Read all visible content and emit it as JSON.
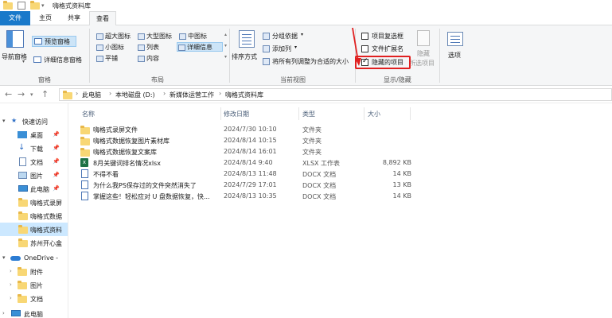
{
  "window": {
    "title": "嗨格式资料库"
  },
  "tabs": {
    "file": "文件",
    "home": "主页",
    "share": "共享",
    "view": "查看"
  },
  "ribbon": {
    "panes": {
      "nav_pane": "导航窗格",
      "preview_pane": "预览窗格",
      "details_pane": "详细信息窗格",
      "group": "窗格"
    },
    "layout": {
      "xl_icons": "超大图标",
      "large_icons": "大型图标",
      "medium_icons": "中图标",
      "small_icons": "小图标",
      "list": "列表",
      "details": "详细信息",
      "tiles": "平铺",
      "content": "内容",
      "group": "布局"
    },
    "current_view": {
      "sort_by": "排序方式",
      "group_by": "分组依据",
      "add_columns": "添加列",
      "size_all_columns": "将所有列调整为合适的大小",
      "group": "当前视图"
    },
    "show_hide": {
      "item_checkboxes": "项目复选框",
      "file_name_extensions": "文件扩展名",
      "hidden_items": "隐藏的项目",
      "hide_selected": "隐藏",
      "hide_selected_2": "所选项目",
      "group": "显示/隐藏",
      "item_checkboxes_checked": false,
      "extensions_checked": false,
      "hidden_items_checked": true
    },
    "options": "选项",
    "colors": {
      "file_tab": "#1979ca",
      "highlight": "#e02020"
    }
  },
  "address": {
    "crumbs": [
      "此电脑",
      "本地磁盘 (D:)",
      "新媒体运营工作",
      "嗨格式资料库"
    ]
  },
  "nav": {
    "quick_access": "快速访问",
    "items": [
      {
        "label": "桌面"
      },
      {
        "label": "下载"
      },
      {
        "label": "文档"
      },
      {
        "label": "图片"
      },
      {
        "label": "此电脑"
      },
      {
        "label": "嗨格式录屏"
      },
      {
        "label": "嗨格式数据"
      },
      {
        "label": "嗨格式资料"
      },
      {
        "label": "苏州开心盒"
      }
    ],
    "onedrive": "OneDrive -",
    "onedrive_items": [
      {
        "label": "附件"
      },
      {
        "label": "图片"
      },
      {
        "label": "文档"
      }
    ],
    "this_pc": "此电脑"
  },
  "list": {
    "headers": {
      "name": "名称",
      "modified": "修改日期",
      "type": "类型",
      "size": "大小"
    },
    "rows": [
      {
        "name": "嗨格式录屏文件",
        "modified": "2024/7/30 10:10",
        "type": "文件夹",
        "size": ""
      },
      {
        "name": "嗨格式数据恢复图片素材库",
        "modified": "2024/8/14 10:15",
        "type": "文件夹",
        "size": ""
      },
      {
        "name": "嗨格式数据恢复文案库",
        "modified": "2024/8/14 16:01",
        "type": "文件夹",
        "size": ""
      },
      {
        "name": "8月关键词排名情况xlsx",
        "modified": "2024/8/14 9:40",
        "type": "XLSX 工作表",
        "size": "8,892 KB"
      },
      {
        "name": "不得不看",
        "modified": "2024/8/13 11:48",
        "type": "DOCX 文档",
        "size": "14 KB"
      },
      {
        "name": "为什么我PS保存过的文件突然消失了",
        "modified": "2024/7/29 17:01",
        "type": "DOCX 文档",
        "size": "13 KB"
      },
      {
        "name": "掌握这些！轻松应对 U 盘数据恢复，快...",
        "modified": "2024/8/13 10:35",
        "type": "DOCX 文档",
        "size": "14 KB"
      }
    ]
  }
}
